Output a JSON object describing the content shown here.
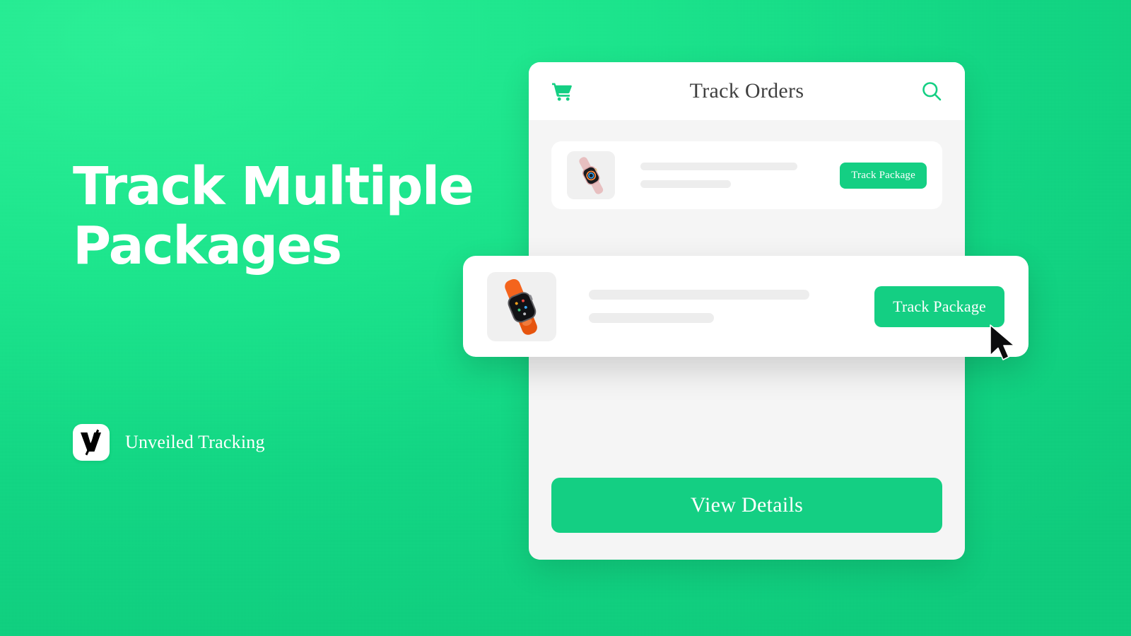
{
  "theme": {
    "brand_green": "#14cf83",
    "bg_green_light": "#2bef96",
    "bg_green_dark": "#0fcb7c",
    "card_white": "#ffffff",
    "panel_gray": "#f5f5f5",
    "skeleton_gray": "#ededed",
    "title_text": "#3f3f3f"
  },
  "hero": {
    "headline": "Track Multiple\nPackages",
    "brand_name": "Unveiled Tracking",
    "logo_glyph": "V"
  },
  "phone": {
    "header": {
      "title": "Track Orders",
      "cart_icon": "shopping-cart-icon",
      "search_icon": "search-icon"
    },
    "orders": [
      {
        "thumbnail": "pink-smartwatch-image",
        "button_label": "Track Package",
        "line1": "",
        "line2": ""
      },
      {
        "thumbnail": "black-smartwatch-image",
        "button_label": "Track Package",
        "line1": "",
        "line2": ""
      }
    ],
    "highlighted_order": {
      "thumbnail": "orange-smartwatch-image",
      "button_label": "Track Package",
      "line1": "",
      "line2": ""
    },
    "view_details_label": "View Details",
    "cursor_icon": "mouse-pointer-icon"
  }
}
